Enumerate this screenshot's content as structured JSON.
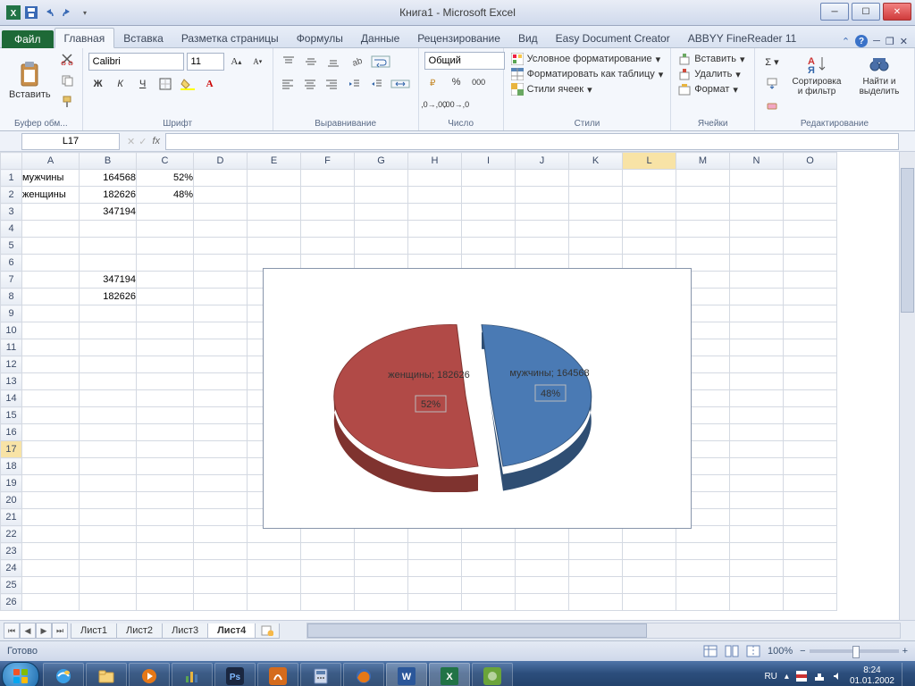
{
  "title": "Книга1 - Microsoft Excel",
  "tabs": {
    "file": "Файл",
    "items": [
      "Главная",
      "Вставка",
      "Разметка страницы",
      "Формулы",
      "Данные",
      "Рецензирование",
      "Вид",
      "Easy Document Creator",
      "ABBYY FineReader 11"
    ],
    "activeIndex": 0
  },
  "ribbon": {
    "clipboard": {
      "paste": "Вставить",
      "label": "Буфер обм..."
    },
    "font": {
      "name": "Calibri",
      "size": "11",
      "label": "Шрифт",
      "bold": "Ж",
      "italic": "К",
      "underline": "Ч"
    },
    "align": {
      "label": "Выравнивание"
    },
    "number": {
      "format": "Общий",
      "label": "Число"
    },
    "styles": {
      "cond": "Условное форматирование",
      "table": "Форматировать как таблицу",
      "cell": "Стили ячеек",
      "label": "Стили"
    },
    "cells": {
      "insert": "Вставить",
      "delete": "Удалить",
      "format": "Формат",
      "label": "Ячейки"
    },
    "editing": {
      "sort": "Сортировка и фильтр",
      "find": "Найти и выделить",
      "label": "Редактирование"
    }
  },
  "namebox": "L17",
  "columns": [
    "A",
    "B",
    "C",
    "D",
    "E",
    "F",
    "G",
    "H",
    "I",
    "J",
    "K",
    "L",
    "M",
    "N",
    "O"
  ],
  "activeCol": "L",
  "activeRow": 17,
  "cells": {
    "A1": "мужчины",
    "B1": "164568",
    "C1": "52%",
    "A2": "женщины",
    "B2": "182626",
    "C2": "48%",
    "B3": "347194",
    "B7": "347194",
    "B8": "182626"
  },
  "colWidths": {
    "A": 64,
    "B": 64,
    "C": 64,
    "default": 60
  },
  "chart_data": {
    "type": "pie",
    "categories": [
      "мужчины",
      "женщины"
    ],
    "values": [
      164568,
      182626
    ],
    "percent_labels": [
      "48%",
      "52%"
    ],
    "data_labels": [
      "мужчины; 164568",
      "женщины; 182626"
    ],
    "colors": [
      "#4a7ab4",
      "#b14a47"
    ]
  },
  "sheets": {
    "items": [
      "Лист1",
      "Лист2",
      "Лист3",
      "Лист4"
    ],
    "activeIndex": 3
  },
  "status": {
    "ready": "Готово",
    "zoom": "100%"
  },
  "tray": {
    "lang": "RU",
    "time": "8:24",
    "date": "01.01.2002"
  }
}
